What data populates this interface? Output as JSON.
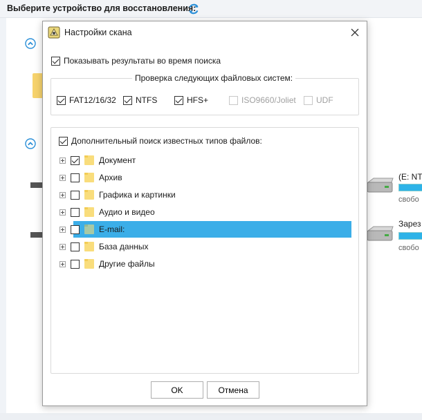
{
  "app": {
    "title": "Выберите устройство для восстановления:",
    "right_drives": [
      {
        "label": "(E: NT",
        "free": "свобо"
      },
      {
        "label": "Зарез",
        "free": "свобо"
      }
    ]
  },
  "dialog": {
    "title": "Настройки скана",
    "show_results": {
      "label": "Показывать результаты во время поиска",
      "checked": true
    },
    "filesystems": {
      "legend": "Проверка следующих файловых систем:",
      "items": [
        {
          "label": "FAT12/16/32",
          "checked": true,
          "enabled": true
        },
        {
          "label": "NTFS",
          "checked": true,
          "enabled": true
        },
        {
          "label": "HFS+",
          "checked": true,
          "enabled": true
        },
        {
          "label": "ISO9660/Joliet",
          "checked": false,
          "enabled": false
        },
        {
          "label": "UDF",
          "checked": false,
          "enabled": false
        }
      ]
    },
    "filetypes": {
      "header": {
        "label": "Дополнительный поиск известных типов файлов:",
        "checked": true
      },
      "items": [
        {
          "label": "Документ",
          "checked": true
        },
        {
          "label": "Архив",
          "checked": false
        },
        {
          "label": "Графика и картинки",
          "checked": false
        },
        {
          "label": "Аудио и видео",
          "checked": false
        },
        {
          "label": "E-mail:",
          "checked": false,
          "selected": true
        },
        {
          "label": "База данных",
          "checked": false
        },
        {
          "label": "Другие файлы",
          "checked": false
        }
      ]
    },
    "ok_label": "OK",
    "cancel_label": "Отмена"
  },
  "colors": {
    "selection": "#3baee8",
    "accent": "#2db3e8",
    "folder": "#f9dd7c"
  }
}
